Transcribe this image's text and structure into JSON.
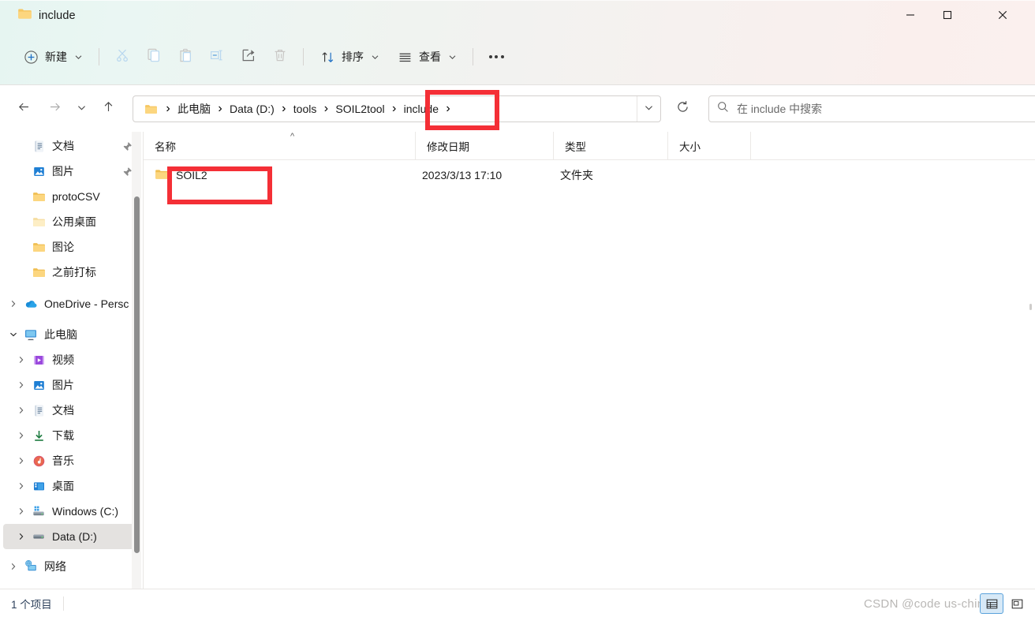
{
  "window": {
    "title": "include",
    "title_icon": "folder-icon",
    "caption": {
      "minimize": "minimize-icon",
      "maximize": "maximize-icon",
      "close": "close-icon"
    }
  },
  "theme": {
    "mica_left": "#e6f5f1",
    "mica_right": "#fbf0ee",
    "annotation_red": "#f42f36",
    "folder_yellow": "#f8cf6b",
    "accent_blue": "#0f6cbd",
    "status_text": "#2c3f5a"
  },
  "toolbar": {
    "new_label": "新建",
    "new_icon": "plus-circle-icon",
    "cut_icon": "scissors-icon",
    "copy_icon": "copy-icon",
    "paste_icon": "clipboard-icon",
    "rename_icon": "rename-icon",
    "share_icon": "share-icon",
    "delete_icon": "trash-icon",
    "sort_label": "排序",
    "sort_icon": "sort-arrows-icon",
    "view_label": "查看",
    "view_icon": "list-lines-icon",
    "more_label": "···",
    "caret_icon": "chevron-down-icon"
  },
  "navigation": {
    "back_icon": "arrow-left-icon",
    "forward_icon": "arrow-right-icon",
    "recent_icon": "chevron-down-icon",
    "up_icon": "arrow-up-icon",
    "refresh_icon": "refresh-icon",
    "address_dropdown_icon": "chevron-down-icon",
    "root_icon": "folder-icon",
    "breadcrumbs": [
      {
        "label": "此电脑"
      },
      {
        "label": "Data (D:)"
      },
      {
        "label": "tools"
      },
      {
        "label": "SOIL2tool"
      },
      {
        "label": "include",
        "highlighted": true
      }
    ],
    "separator": "›"
  },
  "search": {
    "icon": "search-icon",
    "placeholder": "在 include 中搜索",
    "value": ""
  },
  "sidebar": {
    "scrollbar": "vertical-scrollbar",
    "items": [
      {
        "label": "文档",
        "icon": "documents-icon",
        "indent": 1,
        "chevron": false,
        "pinned": true,
        "selected": false
      },
      {
        "label": "图片",
        "icon": "pictures-icon",
        "indent": 1,
        "chevron": false,
        "pinned": true,
        "selected": false
      },
      {
        "label": "protoCSV",
        "icon": "folder-icon",
        "indent": 1,
        "chevron": false,
        "pinned": false,
        "selected": false
      },
      {
        "label": "公用桌面",
        "icon": "folder-pale-icon",
        "indent": 1,
        "chevron": false,
        "pinned": false,
        "selected": false
      },
      {
        "label": "图论",
        "icon": "folder-icon",
        "indent": 1,
        "chevron": false,
        "pinned": false,
        "selected": false
      },
      {
        "label": "之前打标",
        "icon": "folder-icon",
        "indent": 1,
        "chevron": false,
        "pinned": false,
        "selected": false
      },
      {
        "label": "OneDrive - Persc",
        "icon": "onedrive-icon",
        "indent": 0,
        "chevron": true,
        "pinned": false,
        "selected": false
      },
      {
        "label": "此电脑",
        "icon": "this-pc-icon",
        "indent": 0,
        "chevron": true,
        "expanded": true,
        "pinned": false,
        "selected": false
      },
      {
        "label": "视频",
        "icon": "videos-icon",
        "indent": 1,
        "chevron": true,
        "pinned": false,
        "selected": false
      },
      {
        "label": "图片",
        "icon": "pictures-icon",
        "indent": 1,
        "chevron": true,
        "pinned": false,
        "selected": false
      },
      {
        "label": "文档",
        "icon": "documents-icon",
        "indent": 1,
        "chevron": true,
        "pinned": false,
        "selected": false
      },
      {
        "label": "下载",
        "icon": "downloads-icon",
        "indent": 1,
        "chevron": true,
        "pinned": false,
        "selected": false
      },
      {
        "label": "音乐",
        "icon": "music-icon",
        "indent": 1,
        "chevron": true,
        "pinned": false,
        "selected": false
      },
      {
        "label": "桌面",
        "icon": "desktop-icon",
        "indent": 1,
        "chevron": true,
        "pinned": false,
        "selected": false
      },
      {
        "label": "Windows (C:)",
        "icon": "system-drive-icon",
        "indent": 1,
        "chevron": true,
        "pinned": false,
        "selected": false
      },
      {
        "label": "Data (D:)",
        "icon": "drive-icon",
        "indent": 1,
        "chevron": true,
        "pinned": false,
        "selected": true
      },
      {
        "label": "网络",
        "icon": "network-icon",
        "indent": 0,
        "chevron": true,
        "pinned": false,
        "selected": false
      }
    ]
  },
  "filelist": {
    "sort_indicator": "^",
    "columns": [
      {
        "label": "名称",
        "key": "name"
      },
      {
        "label": "修改日期",
        "key": "date"
      },
      {
        "label": "类型",
        "key": "type"
      },
      {
        "label": "大小",
        "key": "size"
      }
    ],
    "rows": [
      {
        "name": "SOIL2",
        "icon": "folder-icon",
        "date": "2023/3/13 17:10",
        "type": "文件夹",
        "size": "",
        "highlighted": true
      }
    ]
  },
  "statusbar": {
    "count": "1 个项目",
    "view_details_icon": "details-view-icon",
    "view_tiles_icon": "large-icons-view-icon",
    "active_view": "details-view-icon",
    "watermark": "CSDN @code us-china"
  },
  "annotations": [
    {
      "name": "include-breadcrumb-highlight",
      "target": "include"
    },
    {
      "name": "soil2-row-highlight",
      "target": "SOIL2"
    }
  ]
}
